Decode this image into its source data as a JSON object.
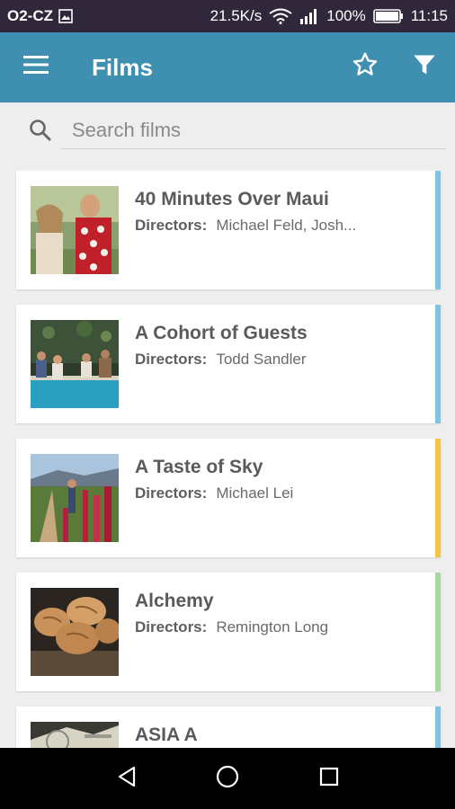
{
  "status_bar": {
    "carrier": "O2-CZ",
    "net_speed": "21.5K/s",
    "battery": "100%",
    "time": "11:15",
    "icons": [
      "image-notification-icon",
      "wifi-icon",
      "signal-icon",
      "battery-icon"
    ]
  },
  "app_bar": {
    "title": "Films",
    "menu_icon": "hamburger-menu-icon",
    "favorite_icon": "star-outline-icon",
    "filter_icon": "filter-funnel-icon",
    "color": "#3e8fb0"
  },
  "search": {
    "placeholder": "Search films",
    "value": "",
    "icon": "search-icon"
  },
  "films": [
    {
      "title": "40 Minutes Over Maui",
      "directors_label": "Directors:",
      "directors": "Michael Feld, Josh...",
      "accent": "#7ec4e6",
      "thumb": "couple-outdoors-thumbnail"
    },
    {
      "title": "A Cohort of Guests",
      "directors_label": "Directors:",
      "directors": "Todd Sandler",
      "accent": "#7ec4e6",
      "thumb": "poolside-group-thumbnail"
    },
    {
      "title": "A Taste of Sky",
      "directors_label": "Directors:",
      "directors": "Michael Lei",
      "accent": "#f6c445",
      "thumb": "flower-field-thumbnail"
    },
    {
      "title": "Alchemy",
      "directors_label": "Directors:",
      "directors": "Remington Long",
      "accent": "#a8d8a0",
      "thumb": "bread-loaves-thumbnail"
    },
    {
      "title": "ASIA A",
      "directors_label": "",
      "directors": "",
      "accent": "#7ec4e6",
      "thumb": "papers-thumbnail"
    }
  ],
  "nav_bar": {
    "back_icon": "back-triangle-icon",
    "home_icon": "home-circle-icon",
    "recents_icon": "recents-square-icon"
  }
}
